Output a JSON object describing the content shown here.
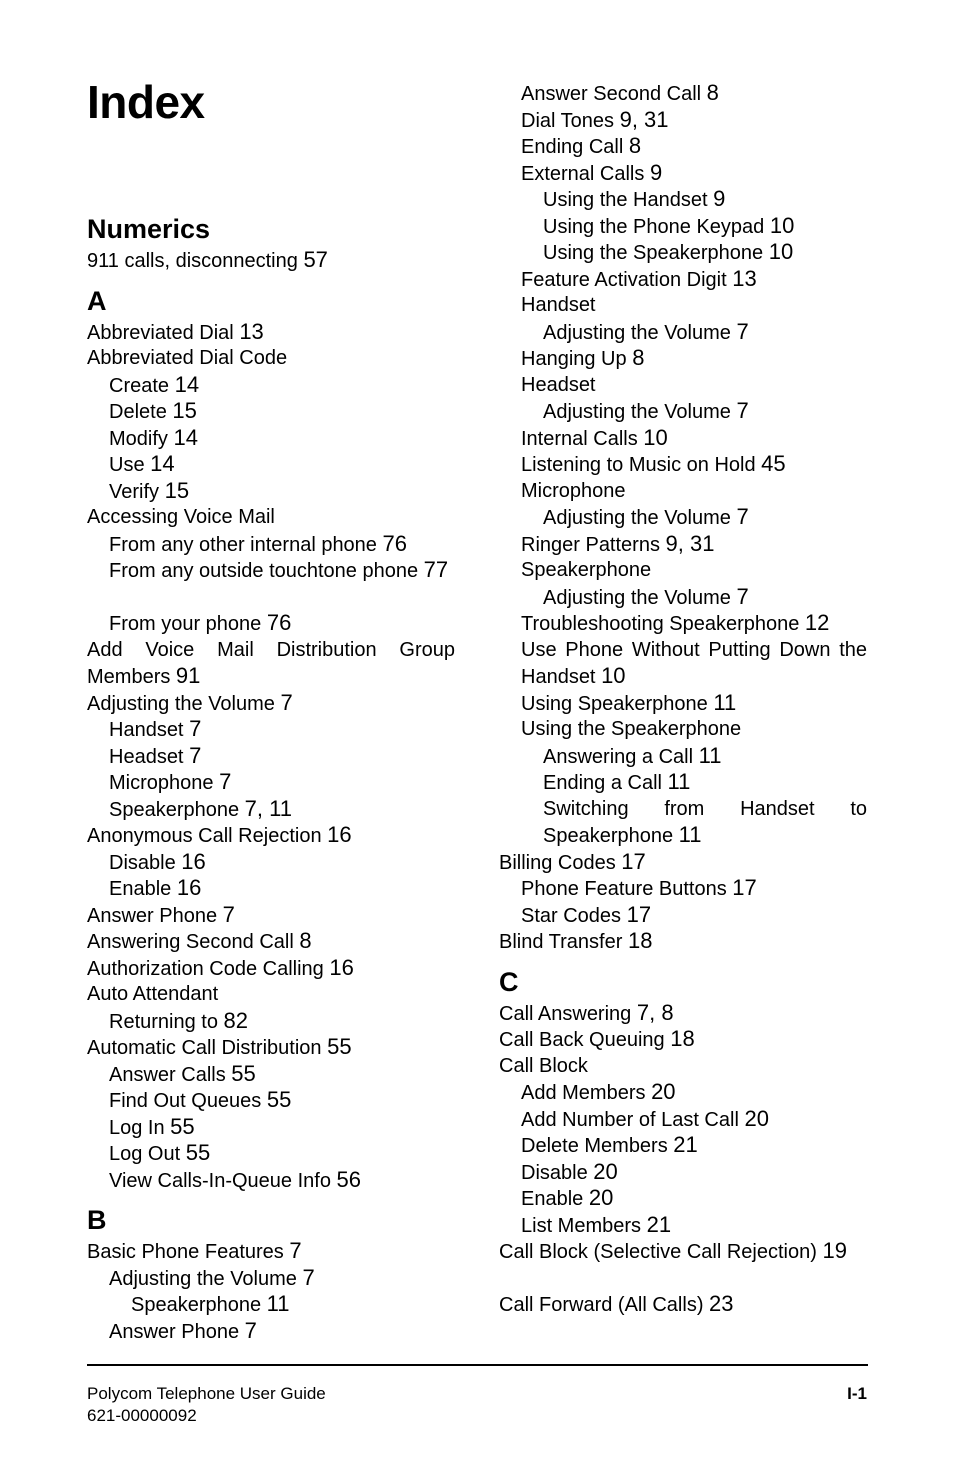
{
  "title": "Index",
  "left_column": [
    {
      "type": "section",
      "label": "Numerics"
    },
    {
      "type": "entry",
      "level": 0,
      "text": "911 calls, disconnecting",
      "pages": "57"
    },
    {
      "type": "section",
      "label": "A"
    },
    {
      "type": "entry",
      "level": 0,
      "text": "Abbreviated Dial",
      "pages": "13"
    },
    {
      "type": "entry",
      "level": 0,
      "text": "Abbreviated Dial Code",
      "pages": ""
    },
    {
      "type": "entry",
      "level": 1,
      "text": "Create",
      "pages": "14"
    },
    {
      "type": "entry",
      "level": 1,
      "text": "Delete",
      "pages": "15"
    },
    {
      "type": "entry",
      "level": 1,
      "text": "Modify",
      "pages": "14"
    },
    {
      "type": "entry",
      "level": 1,
      "text": "Use",
      "pages": "14"
    },
    {
      "type": "entry",
      "level": 1,
      "text": "Verify",
      "pages": "15"
    },
    {
      "type": "entry",
      "level": 0,
      "text": "Accessing Voice Mail",
      "pages": ""
    },
    {
      "type": "entry",
      "level": 1,
      "text": "From any other internal phone",
      "pages": "76"
    },
    {
      "type": "entry",
      "level": 1,
      "text": "From any outside touchtone phone",
      "pages": "77",
      "lines": 2
    },
    {
      "type": "entry",
      "level": 1,
      "text": "From your phone",
      "pages": "76"
    },
    {
      "type": "entry",
      "level": 0,
      "text": "Add Voice Mail Distribution Group Members",
      "pages": "91",
      "lines": 2
    },
    {
      "type": "entry",
      "level": 0,
      "text": "Adjusting the Volume",
      "pages": "7"
    },
    {
      "type": "entry",
      "level": 1,
      "text": "Handset",
      "pages": "7"
    },
    {
      "type": "entry",
      "level": 1,
      "text": "Headset",
      "pages": "7"
    },
    {
      "type": "entry",
      "level": 1,
      "text": "Microphone",
      "pages": "7"
    },
    {
      "type": "entry",
      "level": 1,
      "text": "Speakerphone",
      "pages": "7, 11"
    },
    {
      "type": "entry",
      "level": 0,
      "text": "Anonymous Call Rejection",
      "pages": "16"
    },
    {
      "type": "entry",
      "level": 1,
      "text": "Disable",
      "pages": "16"
    },
    {
      "type": "entry",
      "level": 1,
      "text": "Enable",
      "pages": "16"
    },
    {
      "type": "entry",
      "level": 0,
      "text": "Answer Phone",
      "pages": "7"
    },
    {
      "type": "entry",
      "level": 0,
      "text": "Answering Second Call",
      "pages": "8"
    },
    {
      "type": "entry",
      "level": 0,
      "text": "Authorization Code Calling",
      "pages": "16"
    },
    {
      "type": "entry",
      "level": 0,
      "text": "Auto Attendant",
      "pages": ""
    },
    {
      "type": "entry",
      "level": 1,
      "text": "Returning to",
      "pages": "82"
    },
    {
      "type": "entry",
      "level": 0,
      "text": "Automatic Call Distribution",
      "pages": "55"
    },
    {
      "type": "entry",
      "level": 1,
      "text": "Answer Calls",
      "pages": "55"
    },
    {
      "type": "entry",
      "level": 1,
      "text": "Find Out Queues",
      "pages": "55"
    },
    {
      "type": "entry",
      "level": 1,
      "text": "Log In",
      "pages": "55"
    },
    {
      "type": "entry",
      "level": 1,
      "text": "Log Out",
      "pages": "55"
    },
    {
      "type": "entry",
      "level": 1,
      "text": "View Calls-In-Queue Info",
      "pages": "56"
    },
    {
      "type": "section",
      "label": "B"
    },
    {
      "type": "entry",
      "level": 0,
      "text": "Basic Phone Features",
      "pages": "7"
    },
    {
      "type": "entry",
      "level": 1,
      "text": "Adjusting the Volume",
      "pages": "7"
    },
    {
      "type": "entry",
      "level": 2,
      "text": "Speakerphone",
      "pages": "11"
    },
    {
      "type": "entry",
      "level": 1,
      "text": "Answer Phone",
      "pages": "7"
    }
  ],
  "right_column": [
    {
      "type": "entry",
      "level": 1,
      "text": "Answer Second Call",
      "pages": "8"
    },
    {
      "type": "entry",
      "level": 1,
      "text": "Dial Tones",
      "pages": "9, 31"
    },
    {
      "type": "entry",
      "level": 1,
      "text": "Ending Call",
      "pages": "8"
    },
    {
      "type": "entry",
      "level": 1,
      "text": "External Calls",
      "pages": "9"
    },
    {
      "type": "entry",
      "level": 2,
      "text": "Using the Handset",
      "pages": "9"
    },
    {
      "type": "entry",
      "level": 2,
      "text": "Using the Phone Keypad",
      "pages": "10"
    },
    {
      "type": "entry",
      "level": 2,
      "text": "Using the Speakerphone",
      "pages": "10"
    },
    {
      "type": "entry",
      "level": 1,
      "text": "Feature Activation Digit",
      "pages": "13"
    },
    {
      "type": "entry",
      "level": 1,
      "text": "Handset",
      "pages": ""
    },
    {
      "type": "entry",
      "level": 2,
      "text": "Adjusting the Volume",
      "pages": "7"
    },
    {
      "type": "entry",
      "level": 1,
      "text": "Hanging Up",
      "pages": "8"
    },
    {
      "type": "entry",
      "level": 1,
      "text": "Headset",
      "pages": ""
    },
    {
      "type": "entry",
      "level": 2,
      "text": "Adjusting the Volume",
      "pages": "7"
    },
    {
      "type": "entry",
      "level": 1,
      "text": "Internal Calls",
      "pages": "10"
    },
    {
      "type": "entry",
      "level": 1,
      "text": "Listening to Music on Hold",
      "pages": "45"
    },
    {
      "type": "entry",
      "level": 1,
      "text": "Microphone",
      "pages": ""
    },
    {
      "type": "entry",
      "level": 2,
      "text": "Adjusting the Volume",
      "pages": "7"
    },
    {
      "type": "entry",
      "level": 1,
      "text": "Ringer Patterns",
      "pages": "9, 31"
    },
    {
      "type": "entry",
      "level": 1,
      "text": "Speakerphone",
      "pages": ""
    },
    {
      "type": "entry",
      "level": 2,
      "text": "Adjusting the Volume",
      "pages": "7"
    },
    {
      "type": "entry",
      "level": 1,
      "text": "Troubleshooting Speakerphone",
      "pages": "12"
    },
    {
      "type": "entry",
      "level": 1,
      "text": "Use Phone Without Putting Down the Handset",
      "pages": "10",
      "lines": 2
    },
    {
      "type": "entry",
      "level": 1,
      "text": "Using Speakerphone",
      "pages": "11"
    },
    {
      "type": "entry",
      "level": 1,
      "text": "Using the Speakerphone",
      "pages": ""
    },
    {
      "type": "entry",
      "level": 2,
      "text": "Answering a Call",
      "pages": "11"
    },
    {
      "type": "entry",
      "level": 2,
      "text": "Ending a Call",
      "pages": "11"
    },
    {
      "type": "entry",
      "level": 2,
      "text": "Switching from Handset to Speakerphone",
      "pages": "11",
      "lines": 2
    },
    {
      "type": "entry",
      "level": 0,
      "text": "Billing Codes",
      "pages": "17"
    },
    {
      "type": "entry",
      "level": 1,
      "text": "Phone Feature Buttons",
      "pages": "17"
    },
    {
      "type": "entry",
      "level": 1,
      "text": "Star Codes",
      "pages": "17"
    },
    {
      "type": "entry",
      "level": 0,
      "text": "Blind Transfer",
      "pages": "18"
    },
    {
      "type": "section",
      "label": "C"
    },
    {
      "type": "entry",
      "level": 0,
      "text": "Call Answering",
      "pages": "7, 8"
    },
    {
      "type": "entry",
      "level": 0,
      "text": "Call Back Queuing",
      "pages": "18"
    },
    {
      "type": "entry",
      "level": 0,
      "text": "Call Block",
      "pages": ""
    },
    {
      "type": "entry",
      "level": 1,
      "text": "Add Members",
      "pages": "20"
    },
    {
      "type": "entry",
      "level": 1,
      "text": "Add Number of Last Call",
      "pages": "20"
    },
    {
      "type": "entry",
      "level": 1,
      "text": "Delete Members",
      "pages": "21"
    },
    {
      "type": "entry",
      "level": 1,
      "text": "Disable",
      "pages": "20"
    },
    {
      "type": "entry",
      "level": 1,
      "text": "Enable",
      "pages": "20"
    },
    {
      "type": "entry",
      "level": 1,
      "text": "List Members",
      "pages": "21"
    },
    {
      "type": "entry",
      "level": 0,
      "text": "Call Block (Selective Call Rejection)",
      "pages": "19",
      "lines": 2
    },
    {
      "type": "entry",
      "level": 0,
      "text": "Call Forward (All Calls)",
      "pages": "23"
    }
  ],
  "footer": {
    "doc_title": "Polycom Telephone User Guide",
    "doc_number": "621-00000092",
    "page_number": "I-1"
  }
}
